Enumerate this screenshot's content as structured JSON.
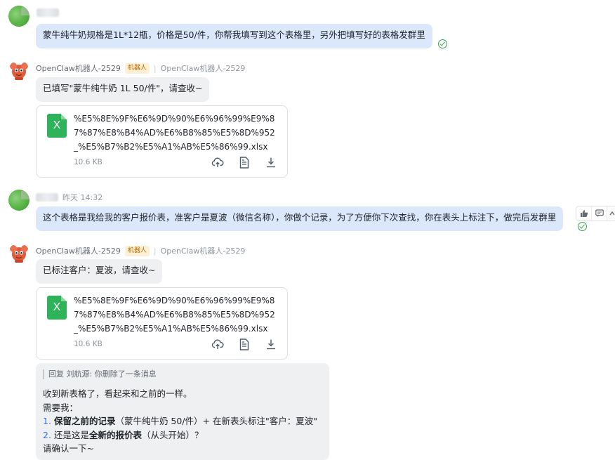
{
  "messages": [
    {
      "type": "user",
      "text": "蒙牛纯牛奶规格是1L*12瓶，价格是50/件，你帮我填写到这个表格里，另外把填写好的表格发群里"
    },
    {
      "type": "bot",
      "sender": "OpenClaw机器人-2529",
      "tag": "机器人",
      "group_name": "OpenClaw机器人-2529",
      "text": "已填写\"蒙牛纯牛奶 1L 50/件\"，请查收~",
      "file": {
        "name": "%E5%8E%9F%E6%9D%90%E6%96%99%E9%87%87%E8%B4%AD%E6%B8%85%E5%8D%952_%E5%B7%B2%E5%A1%AB%E5%86%99.xlsx",
        "size": "10.6 KB",
        "icon_letter": "X"
      }
    },
    {
      "type": "user",
      "time": "昨天 14:32",
      "text": "这个表格是我给我的客户报价表，准客户是夏波（微信名称），你做个记录，为了方便你下次查找，你在表头上标注下，做完后发群里"
    },
    {
      "type": "bot",
      "sender": "OpenClaw机器人-2529",
      "tag": "机器人",
      "group_name": "OpenClaw机器人-2529",
      "text": "已标注客户：夏波，请查收~",
      "file": {
        "name": "%E5%8E%9F%E6%9D%90%E6%96%99%E9%87%87%E8%B4%AD%E6%B8%85%E5%8D%952_%E5%B7%B2%E5%A1%AB%E5%86%99.xlsx",
        "size": "10.6 KB",
        "icon_letter": "X"
      }
    }
  ],
  "reply": {
    "quote": "回复 刘航源: 你删除了一条消息",
    "line1": "收到新表格了，看起来和之前的一样。",
    "line2": "需要我：",
    "item1_num": "1.",
    "item1_bold": "保留之前的记录",
    "item1_rest": "（蒙牛纯牛奶 50/件）+ 在新表头标注\"客户：夏波\"",
    "item2_num": "2.",
    "item2_pre": "还是这是",
    "item2_bold": "全新的报价表",
    "item2_rest": "（从头开始）？",
    "line_last": "请确认一下~"
  },
  "icons": {
    "read": "check-circle-icon",
    "file_actions": [
      "cloud-save-icon",
      "preview-doc-icon",
      "download-icon"
    ],
    "hover_tools": [
      "thumbs-up-icon",
      "reply-icon",
      "more-icon"
    ]
  },
  "colors": {
    "user_bubble": "#dbe7fb",
    "bot_bubble": "#eff0f1",
    "excel_green": "#2fb35a",
    "read_green": "#34a853",
    "bot_tag_bg": "#fdf0d5"
  }
}
